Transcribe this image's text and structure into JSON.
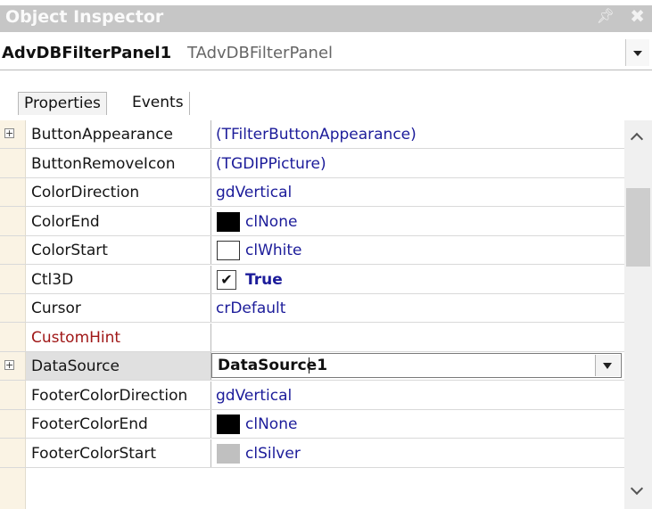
{
  "window": {
    "title": "Object Inspector",
    "pin_icon": "pin-icon",
    "close_icon": "close-icon"
  },
  "object_selector": {
    "name": "AdvDBFilterPanel1",
    "type": "TAdvDBFilterPanel"
  },
  "tabs": [
    {
      "label": "Properties",
      "active": true
    },
    {
      "label": "Events",
      "active": false
    }
  ],
  "properties": [
    {
      "name": "ButtonAppearance",
      "value": "(TFilterButtonAppearance)",
      "expandable": true
    },
    {
      "name": "ButtonRemoveIcon",
      "value": "(TGDIPPicture)"
    },
    {
      "name": "ColorDirection",
      "value": "gdVertical"
    },
    {
      "name": "ColorEnd",
      "value": "clNone",
      "swatch": "#000000"
    },
    {
      "name": "ColorStart",
      "value": "clWhite",
      "swatch": "#ffffff"
    },
    {
      "name": "Ctl3D",
      "value": "True",
      "checkbox": true
    },
    {
      "name": "Cursor",
      "value": "crDefault"
    },
    {
      "name": "CustomHint",
      "value": "",
      "color": "#a01818"
    },
    {
      "name": "DataSource",
      "value": "DataSource1",
      "expandable": true,
      "selected": true
    },
    {
      "name": "FooterColorDirection",
      "value": "gdVertical"
    },
    {
      "name": "FooterColorEnd",
      "value": "clNone",
      "swatch": "#000000"
    },
    {
      "name": "FooterColorStart",
      "value": "clSilver",
      "swatch": "#c0c0c0"
    }
  ],
  "colors": {
    "value_text": "#1c1c9a",
    "gutter": "#faf3e4",
    "title_bar": "#c6c6c6"
  }
}
